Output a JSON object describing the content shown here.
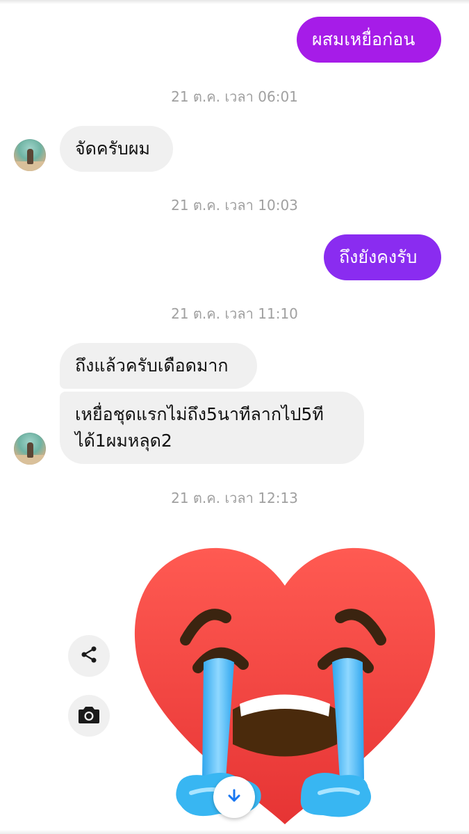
{
  "messages": {
    "out_1": "ผสมเหยื่อก่อน",
    "ts_1": "21 ต.ค. เวลา 06:01",
    "in_1": "จัดครับผม",
    "ts_2": "21 ต.ค. เวลา 10:03",
    "out_2": "ถึงยังคงรับ",
    "ts_3": "21 ต.ค. เวลา 11:10",
    "in_2": "ถึงแล้วครับเดือดมาก",
    "in_3_line1": "เหยื่อชุดแรกไม่ถึง5นาทีลากไป5ที",
    "in_3_line2": "ได้1ผมหลุด2",
    "ts_4": "21 ต.ค. เวลา 12:13"
  },
  "sticker": {
    "name": "crying-heart-sticker"
  },
  "actions": {
    "share_icon": "share-icon",
    "camera_icon": "camera-icon",
    "scroll_icon": "arrow-down-icon"
  },
  "colors": {
    "outgoing_bubble_1": "#a61ce8",
    "outgoing_bubble_2": "#8a2cf0",
    "incoming_bubble": "#f0f0f0",
    "timestamp_text": "#a0a0a0",
    "heart_red": "#f04646",
    "tear_blue": "#38b6f2",
    "scroll_arrow": "#1877f2"
  }
}
